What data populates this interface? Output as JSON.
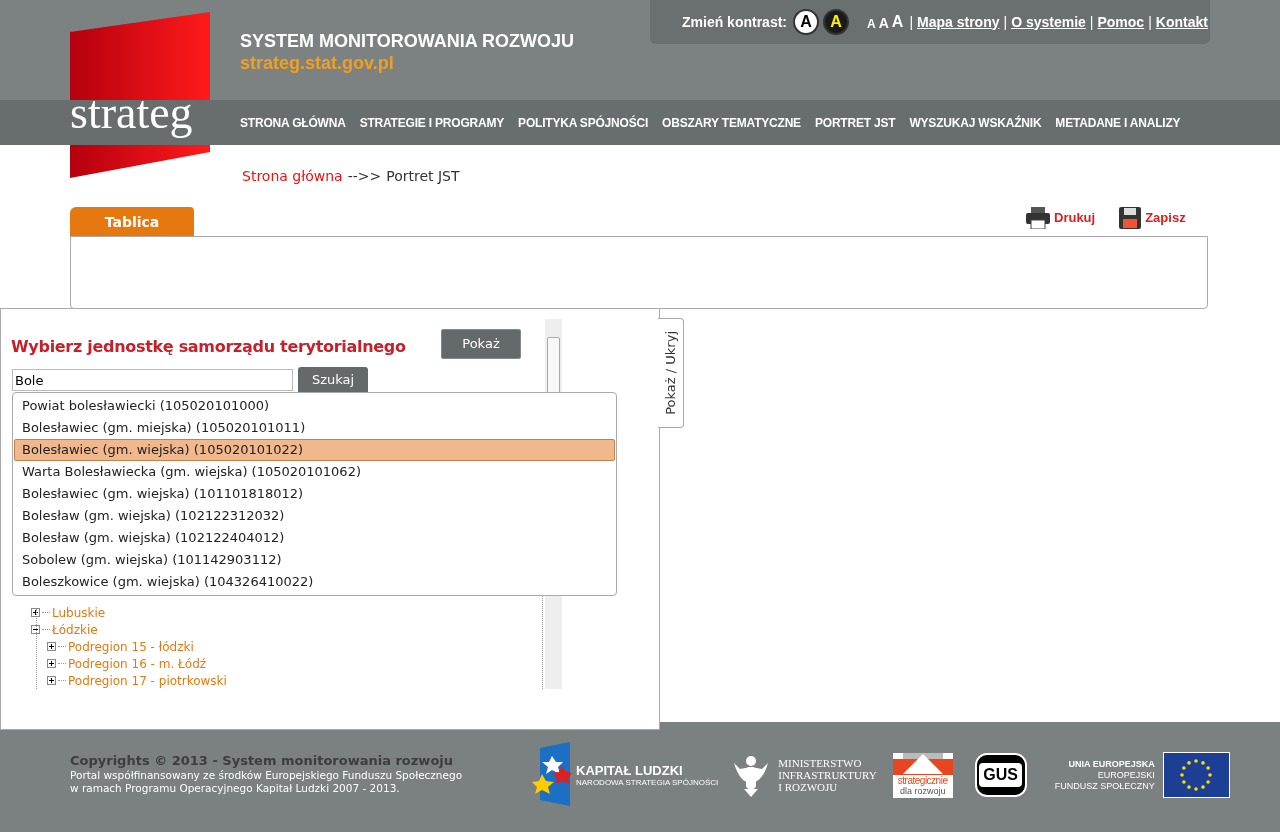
{
  "header": {
    "logo_text": "strateg",
    "title": "SYSTEM MONITOROWANIA ROZWOJU",
    "url": "strateg.stat.gov.pl"
  },
  "top_links": {
    "contrast_label": "Zmień kontrast:",
    "contrast_buttons": [
      {
        "label": "A",
        "kind": "normal"
      },
      {
        "label": "A",
        "kind": "high"
      }
    ],
    "font_sizes": [
      "A",
      "A",
      "A"
    ],
    "separator": "|",
    "links": [
      "Mapa strony",
      "O systemie",
      "Pomoc",
      "Kontakt"
    ]
  },
  "nav": [
    "STRONA GŁÓWNA",
    "STRATEGIE I PROGRAMY",
    "POLITYKA SPÓJNOŚCI",
    "OBSZARY TEMATYCZNE",
    "PORTRET JST",
    "WYSZUKAJ WSKAŹNIK",
    "METADANE I ANALIZY"
  ],
  "breadcrumb": {
    "home": "Strona główna",
    "separator": "-->>",
    "current": "Portret JST"
  },
  "tabs": [
    {
      "label": "Tablica",
      "selected": true
    }
  ],
  "actions": [
    {
      "label": "Drukuj",
      "kind": "print"
    },
    {
      "label": "Zapisz",
      "kind": "save"
    }
  ],
  "selector": {
    "title": "Wybierz jednostkę samorządu terytorialnego",
    "show_button": "Pokaż",
    "search": {
      "value": "Bole"
    },
    "search_button": "Szukaj",
    "toggle_label": "Pokaż / Ukryj",
    "suggestions": [
      {
        "label": "Powiat bolesławiecki (105020101000)",
        "selected": false
      },
      {
        "label": "Bolesławiec (gm. miejska) (105020101011)",
        "selected": false
      },
      {
        "label": "Bolesławiec (gm. wiejska) (105020101022)",
        "selected": true
      },
      {
        "label": "Warta Bolesławiecka (gm. wiejska) (105020101062)",
        "selected": false
      },
      {
        "label": "Bolesławiec (gm. wiejska) (101101818012)",
        "selected": false
      },
      {
        "label": "Bolesław (gm. wiejska) (102122312032)",
        "selected": false
      },
      {
        "label": "Bolesław (gm. wiejska) (102122404012)",
        "selected": false
      },
      {
        "label": "Sobolew (gm. wiejska) (101142903112)",
        "selected": false
      },
      {
        "label": "Boleszkowice (gm. wiejska) (104326410022)",
        "selected": false
      }
    ],
    "tree": [
      {
        "label": "Lubuskie",
        "expanded": false
      },
      {
        "label": "Łódzkie",
        "expanded": true,
        "children": [
          {
            "label": "Podregion 15 - łódzki",
            "expanded": false
          },
          {
            "label": "Podregion 16 - m. Łódź",
            "expanded": false
          },
          {
            "label": "Podregion 17 - piotrkowski",
            "expanded": false
          }
        ]
      }
    ]
  },
  "footer": {
    "copyright": "Copyrights © 2013 - System monitorowania rozwoju",
    "note_lines": [
      "Portal współfinansowany ze środków Europejskiego Funduszu Społecznego",
      "w ramach Programu Operacyjnego Kapitał Ludzki 2007 - 2013."
    ],
    "logos": [
      {
        "kind": "kapital",
        "lines": [
          "KAPITAŁ LUDZKI",
          "NARODOWA STRATEGIA SPÓJNOŚCI"
        ]
      },
      {
        "kind": "ministry",
        "lines": [
          "MINISTERSTWO",
          "INFRASTRUKTURY",
          "I ROZWOJU"
        ]
      },
      {
        "kind": "strategicznie",
        "lines": [
          "strategicznie",
          "dla rozwoju"
        ]
      },
      {
        "kind": "gus",
        "lines": [
          "GUS"
        ]
      },
      {
        "kind": "eu",
        "lines": [
          "UNIA EUROPEJSKA",
          "EUROPEJSKI",
          "FUNDUSZ SPOŁECZNY"
        ]
      }
    ]
  }
}
